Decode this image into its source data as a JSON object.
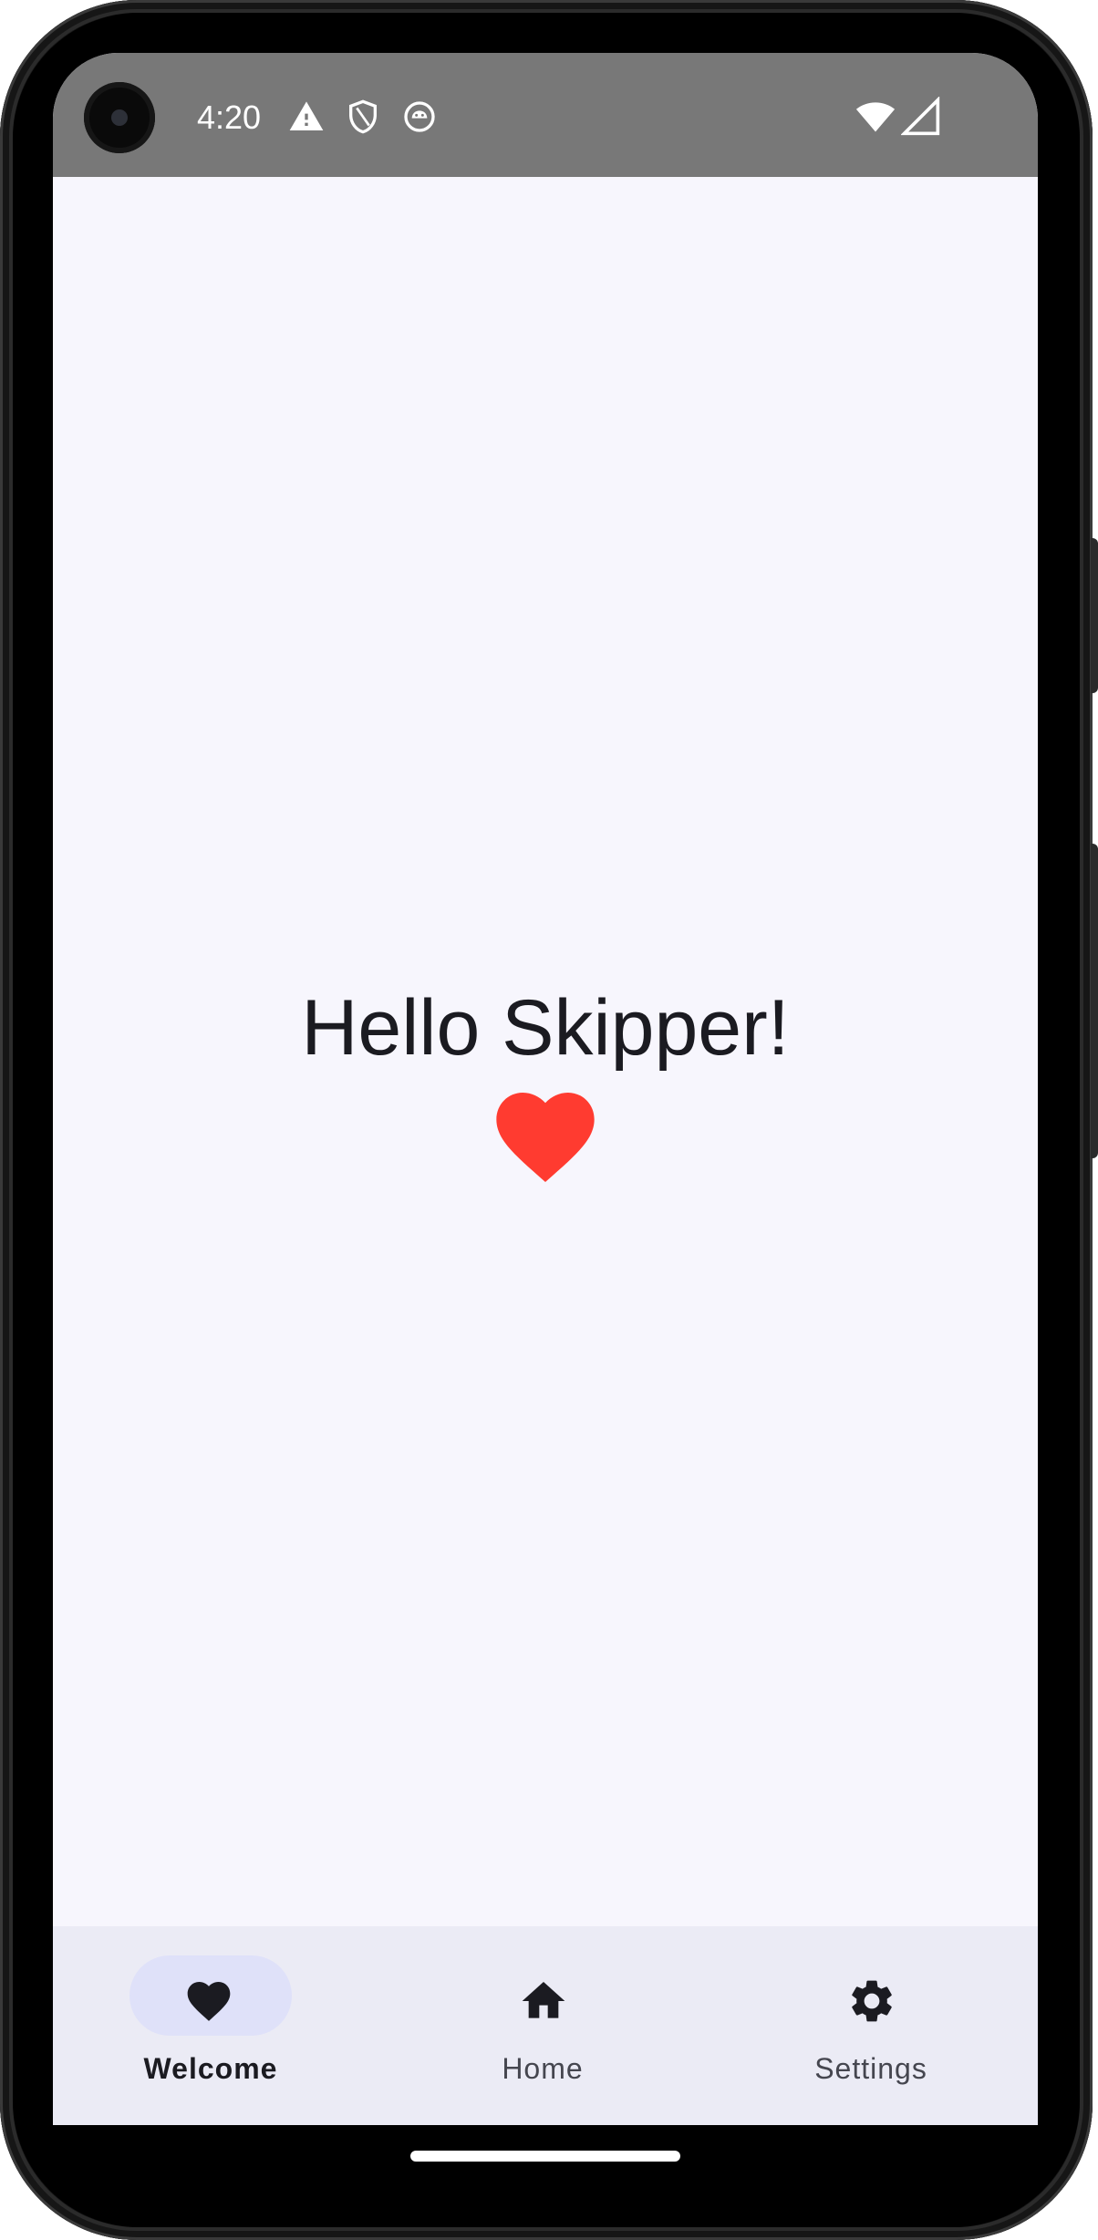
{
  "status_bar": {
    "time": "4:20",
    "left_icons": [
      "warning-icon",
      "shield-icon",
      "android-icon"
    ],
    "right_icons": [
      "wifi-icon",
      "cell-signal-icon"
    ]
  },
  "main": {
    "greeting": "Hello Skipper!",
    "icon": "heart-icon",
    "icon_color": "#ff3b30"
  },
  "bottom_nav": {
    "items": [
      {
        "label": "Welcome",
        "icon": "heart-icon",
        "selected": true
      },
      {
        "label": "Home",
        "icon": "home-icon",
        "selected": false
      },
      {
        "label": "Settings",
        "icon": "gear-icon",
        "selected": false
      }
    ]
  },
  "colors": {
    "background": "#f7f6fd",
    "nav_background": "#ebebf5",
    "selected_pill": "#dfe1f9",
    "status_bar": "#787878",
    "text": "#1b1b21"
  }
}
